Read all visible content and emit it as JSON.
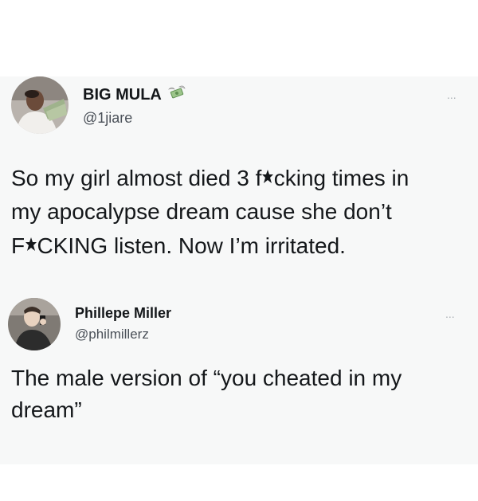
{
  "tweets": [
    {
      "display_name": "BIG MULA",
      "badge_icon": "money-with-wings-icon",
      "handle": "@1jiare",
      "more_label": "...",
      "text_lines": [
        {
          "before": "So my girl almost died 3 f",
          "censor_icon": "censor-star-icon",
          "after": "cking times in"
        },
        {
          "text": "my apocalypse dream cause she don’t"
        },
        {
          "before": "F",
          "censor_icon": "censor-star-icon",
          "after": "CKING listen. Now I’m irritated."
        }
      ]
    },
    {
      "display_name": "Phillepe Miller",
      "handle": "@philmillerz",
      "more_label": "...",
      "text_lines": [
        {
          "text": "The male version of “you cheated in my"
        },
        {
          "text": "dream”"
        }
      ]
    }
  ],
  "colors": {
    "text": "#14171a",
    "handle": "#4a5058",
    "more": "#a8aeb3",
    "tweet_background": "#f7f8f8"
  }
}
